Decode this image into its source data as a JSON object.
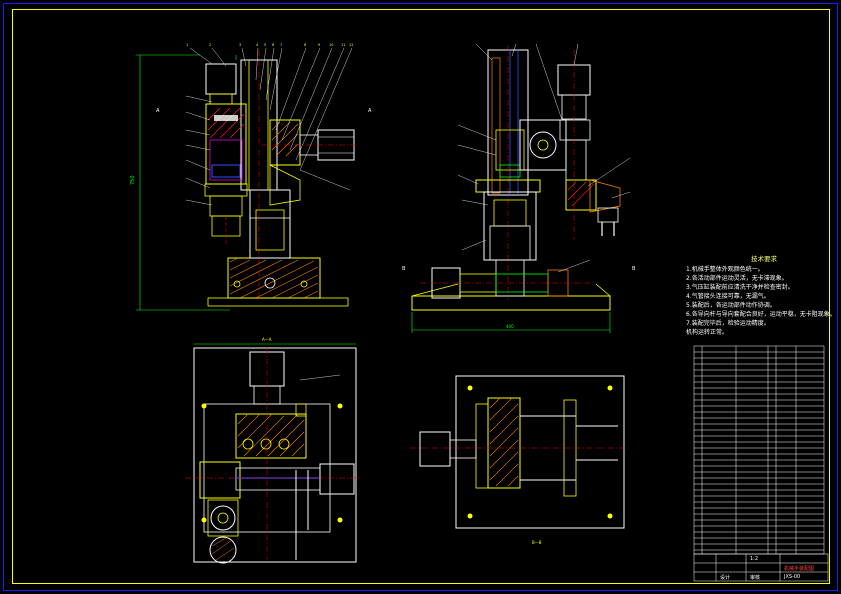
{
  "colors": {
    "background": "#000000",
    "frame": "#1a1aff",
    "border": "#ffff00",
    "outline": "#ffffff",
    "part": "#ffff00",
    "hatch": "#ff8000",
    "red_part": "#ff2020",
    "centerline": "#ff0000",
    "dimension": "#00ff00",
    "leader": "#ffffff",
    "blue_part": "#3050ff",
    "magenta": "#ff00ff"
  },
  "technical_notes": {
    "title": "技术要求",
    "items": [
      "1.机械手整体外观颜色统一。",
      "2.各活动部件运动灵活，无卡滞现象。",
      "3.气压缸装配前应清洗干净并检查密封。",
      "4.气管接头连接可靠，无漏气。",
      "5.装配后，各运动部件动作协调。",
      "6.各导向杆与导向套配合良好，运动平稳，无卡阻现象。",
      "7.装配完毕后，检验运动精度。",
      "  机构运转正常。"
    ]
  },
  "title_block": {
    "drawing_name": "机械手装配图",
    "drawing_no": "JXS-00",
    "scale": "1:2",
    "design_label": "设计",
    "check_label": "审核"
  }
}
